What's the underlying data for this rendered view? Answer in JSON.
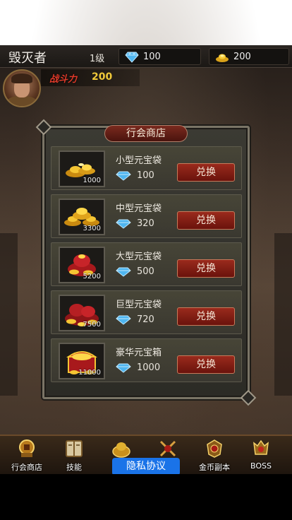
{
  "player": {
    "name": "毁灭者",
    "level": "1级",
    "diamonds": "100",
    "gold": "200"
  },
  "power": {
    "label": "战斗力",
    "value": "200"
  },
  "shop": {
    "title": "行会商店",
    "buy_label": "兑换",
    "items": [
      {
        "name": "小型元宝袋",
        "quantity": "1000",
        "price": "100"
      },
      {
        "name": "中型元宝袋",
        "quantity": "3300",
        "price": "320"
      },
      {
        "name": "大型元宝袋",
        "quantity": "5200",
        "price": "500"
      },
      {
        "name": "巨型元宝袋",
        "quantity": "7500",
        "price": "720"
      },
      {
        "name": "豪华元宝箱",
        "quantity": "11000",
        "price": "1000"
      }
    ]
  },
  "nav": {
    "items": [
      {
        "label": "行会商店",
        "icon": "guild-shop-icon"
      },
      {
        "label": "技能",
        "icon": "skill-book-icon"
      },
      {
        "label": "",
        "icon": "treasure-icon"
      },
      {
        "label": "",
        "icon": "crossed-swords-icon"
      },
      {
        "label": "金币副本",
        "icon": "gold-dungeon-icon"
      },
      {
        "label": "BOSS",
        "icon": "boss-icon"
      }
    ]
  },
  "privacy": {
    "label": "隐私协议"
  },
  "colors": {
    "diamond": "#4fb6f0",
    "gold": "#f0c93a",
    "button": "#8a2216",
    "power": "#e03a2a"
  }
}
